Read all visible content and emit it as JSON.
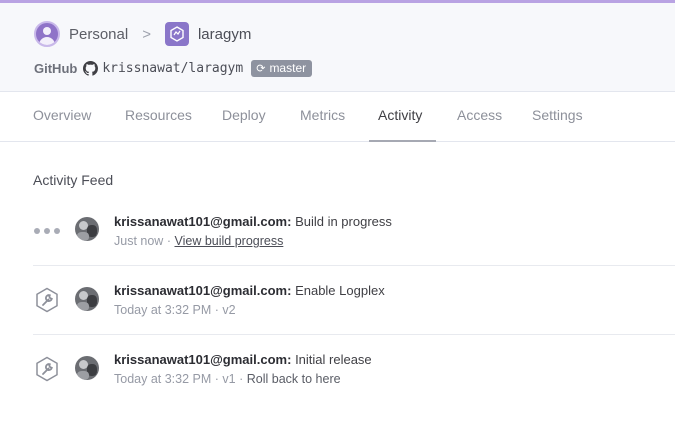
{
  "breadcrumb": {
    "account": "Personal",
    "separator": ">",
    "app": "laragym"
  },
  "source": {
    "provider": "GitHub",
    "repo": "krissnawat/laragym",
    "branch": "master"
  },
  "tabs": [
    {
      "label": "Overview",
      "active": false
    },
    {
      "label": "Resources",
      "active": false
    },
    {
      "label": "Deploy",
      "active": false
    },
    {
      "label": "Metrics",
      "active": false
    },
    {
      "label": "Activity",
      "active": true
    },
    {
      "label": "Access",
      "active": false
    },
    {
      "label": "Settings",
      "active": false
    }
  ],
  "feed": {
    "title": "Activity Feed",
    "items": [
      {
        "icon": "in-progress-dots-icon",
        "user": "krissanawat101@gmail.com:",
        "message": "Build in progress",
        "time": "Just now",
        "sep": "·",
        "link": "View build progress"
      },
      {
        "icon": "wrench-icon",
        "user": "krissanawat101@gmail.com:",
        "message": "Enable Logplex",
        "time": "Today at 3:32 PM",
        "sep": "·",
        "version": "v2"
      },
      {
        "icon": "wrench-icon",
        "user": "krissanawat101@gmail.com:",
        "message": "Initial release",
        "time": "Today at 3:32 PM",
        "sep": "·",
        "version": "v1",
        "sep2": "·",
        "action": "Roll back to here"
      }
    ]
  },
  "colors": {
    "accent": "#b9a3e3",
    "app_icon": "#8a76c9",
    "header_bg": "#f7f8fb"
  }
}
